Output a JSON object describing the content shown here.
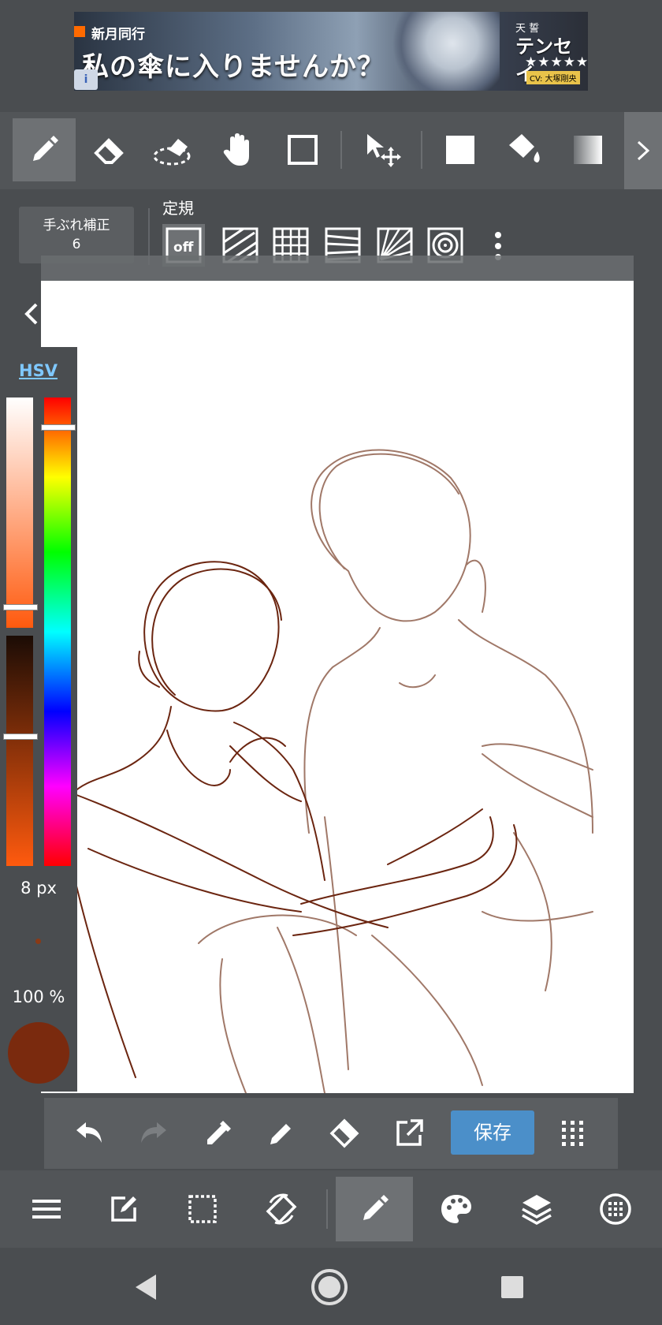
{
  "ad": {
    "top_text": "新月同行",
    "main_text": "私の傘に入りませんか？",
    "right_top": "天 誓",
    "right_main": "テンセイ",
    "stars": "★★★★★",
    "cv_text": "CV: 大塚剛央",
    "info_icon": "i"
  },
  "toolbar": {
    "tools": [
      {
        "name": "pen-tool",
        "icon": "pencil-icon",
        "active": true
      },
      {
        "name": "eraser-tool",
        "icon": "eraser-icon"
      },
      {
        "name": "blur-eraser-tool",
        "icon": "blur-eraser-icon"
      },
      {
        "name": "hand-tool",
        "icon": "hand-icon"
      },
      {
        "name": "shape-tool",
        "icon": "square-outline-icon"
      },
      {
        "name": "move-tool",
        "icon": "move-arrow-icon"
      },
      {
        "name": "fill-tool",
        "icon": "filled-square-icon"
      },
      {
        "name": "bucket-tool",
        "icon": "paint-bucket-icon"
      },
      {
        "name": "gradient-tool",
        "icon": "gradient-icon"
      }
    ],
    "more_icon": "chevron-right-icon"
  },
  "subtoolbar": {
    "stabilizer_label": "手ぶれ補正",
    "stabilizer_value": "6",
    "ruler_label": "定規",
    "rulers": [
      {
        "name": "ruler-off",
        "label": "off",
        "active": true
      },
      {
        "name": "ruler-parallel",
        "icon": "parallel-lines-icon"
      },
      {
        "name": "ruler-grid",
        "icon": "grid-icon"
      },
      {
        "name": "ruler-perspective",
        "icon": "perspective-lines-icon"
      },
      {
        "name": "ruler-radial",
        "icon": "radial-lines-icon"
      },
      {
        "name": "ruler-concentric",
        "icon": "concentric-circles-icon"
      }
    ],
    "more_icon": "vertical-dots-icon"
  },
  "color_panel": {
    "mode_label": "HSV",
    "brush_size": "8 px",
    "opacity": "100 %",
    "current_color": "#7a2a0e",
    "hue_color": "#ff5a0e",
    "saturation_level": 0.9,
    "value_level": 0.42,
    "hue_level": 0.06
  },
  "actionbar": {
    "save_label": "保存",
    "icons": [
      "undo-icon",
      "redo-icon",
      "eyedropper-icon",
      "pencil-icon",
      "eraser-icon",
      "export-icon",
      "grid-dots-icon"
    ]
  },
  "bottomnav": {
    "icons": [
      "menu-icon",
      "edit-icon",
      "selection-icon",
      "rotate-icon",
      "pen-icon",
      "palette-icon",
      "layers-icon",
      "materials-icon"
    ]
  },
  "sysnav": {
    "icons": [
      "back-triangle-icon",
      "home-circle-icon",
      "recents-square-icon"
    ]
  },
  "colors": {
    "sketch_light": "#a07868",
    "sketch_dark": "#6b2510",
    "accent_blue": "#4b8fc9"
  }
}
